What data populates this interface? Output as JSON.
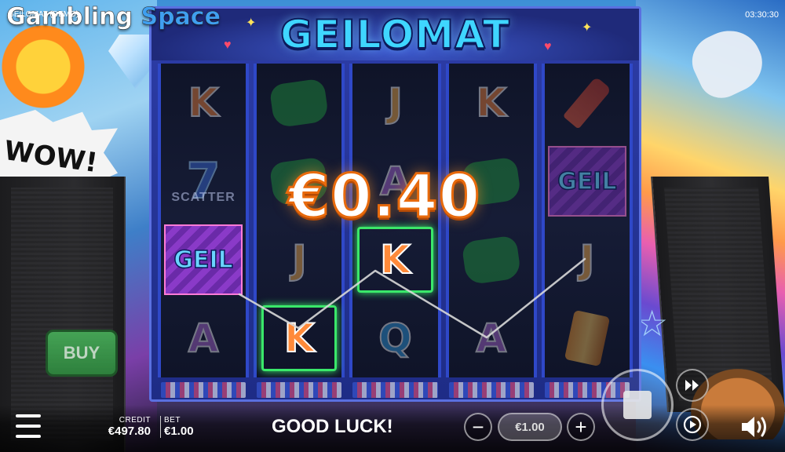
{
  "topbar": {
    "brand_main": "Gambling",
    "brand_accent": "Space",
    "game_name": "GEILOMAT (DEMO)",
    "clock": "03:30:30"
  },
  "game": {
    "logo": "GEILOMAT",
    "win_amount": "€0.40",
    "message": "GOOD LUCK!"
  },
  "reels": [
    [
      "K",
      "7",
      "geil",
      "A"
    ],
    [
      "gem",
      "gem",
      "J",
      "K"
    ],
    [
      "J",
      "A",
      "K",
      "Q"
    ],
    [
      "K",
      "gem",
      "gem",
      "A"
    ],
    [
      "bottle",
      "geil",
      "J",
      "can"
    ]
  ],
  "symbols": {
    "scatter_label": "SCATTER",
    "geil_label": "GEIL"
  },
  "deco": {
    "comic_text": "WOW!"
  },
  "controls": {
    "buy_label": "BUY",
    "credit_label": "CREDIT",
    "credit_value": "€497.80",
    "bet_label": "BET",
    "bet_value": "€1.00",
    "bet_pill": "€1.00",
    "minus": "−",
    "plus": "+"
  },
  "icons": [
    "menu-icon",
    "minus-icon",
    "plus-icon",
    "stop-icon",
    "fast-forward-icon",
    "autoplay-icon",
    "speaker-icon"
  ],
  "colors": {
    "win_outline": "#e86a0c",
    "win_frame": "#3ae86a",
    "cabinet": "#2d3da8",
    "buy": "#48b05a"
  }
}
